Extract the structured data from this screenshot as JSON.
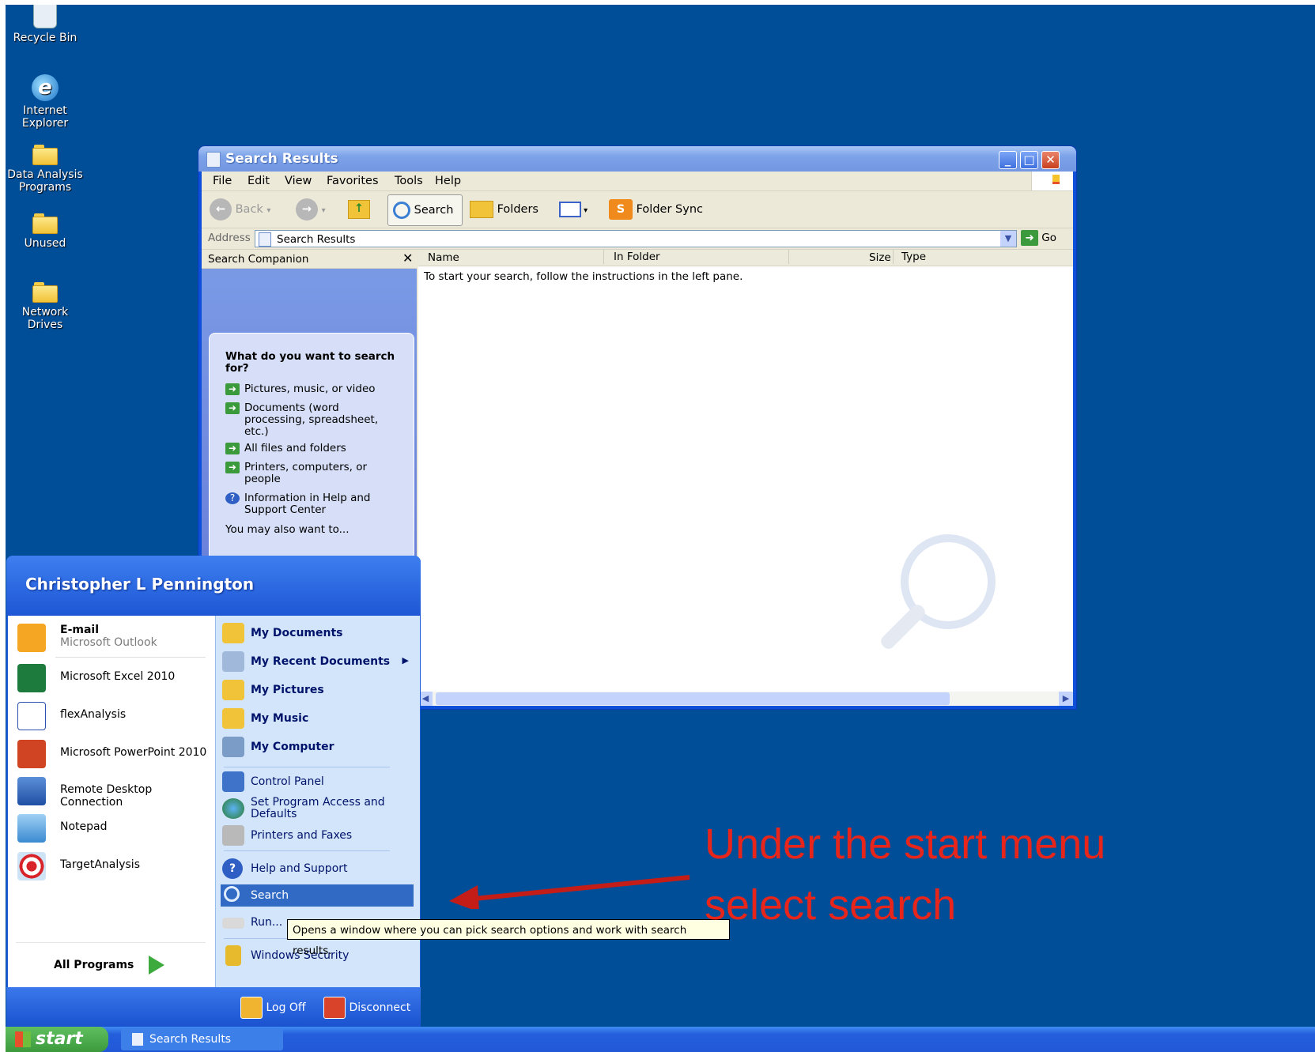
{
  "desktop": {
    "icons": [
      {
        "label": "Recycle Bin"
      },
      {
        "label": "Internet\nExplorer"
      },
      {
        "label": "Data Analysis\nPrograms"
      },
      {
        "label": "Unused"
      },
      {
        "label": "Network\nDrives"
      }
    ]
  },
  "window": {
    "title": "Search Results",
    "menu": [
      "File",
      "Edit",
      "View",
      "Favorites",
      "Tools",
      "Help"
    ],
    "toolbar": {
      "back": "Back",
      "search": "Search",
      "folders": "Folders",
      "folder_sync": "Folder Sync"
    },
    "address": {
      "label": "Address",
      "value": "Search Results",
      "go": "Go"
    },
    "companion": {
      "title": "Search Companion",
      "question": "What do you want to search for?",
      "options": [
        "Pictures, music, or video",
        "Documents (word processing, spreadsheet, etc.)",
        "All files and folders",
        "Printers, computers, or people",
        "Information in Help and Support Center"
      ],
      "also": "You may also want to..."
    },
    "columns": [
      "Name",
      "In Folder",
      "Size",
      "Type"
    ],
    "empty_message": "To start your search, follow the instructions in the left pane."
  },
  "start_menu": {
    "user": "Christopher L Pennington",
    "left_items": [
      {
        "label": "E-mail",
        "sub": "Microsoft Outlook"
      },
      {
        "label": "Microsoft Excel 2010"
      },
      {
        "label": "flexAnalysis"
      },
      {
        "label": "Microsoft PowerPoint 2010"
      },
      {
        "label": "Remote Desktop Connection"
      },
      {
        "label": "Notepad"
      },
      {
        "label": "TargetAnalysis"
      }
    ],
    "all_programs": "All Programs",
    "right_items": [
      {
        "label": "My Documents"
      },
      {
        "label": "My Recent Documents"
      },
      {
        "label": "My Pictures"
      },
      {
        "label": "My Music"
      },
      {
        "label": "My Computer"
      },
      {
        "label": "Control Panel"
      },
      {
        "label": "Set Program Access and Defaults"
      },
      {
        "label": "Printers and Faxes"
      },
      {
        "label": "Help and Support"
      },
      {
        "label": "Search"
      },
      {
        "label": "Run..."
      },
      {
        "label": "Windows Security"
      }
    ],
    "log_off": "Log Off",
    "disconnect": "Disconnect"
  },
  "tooltip": "Opens a window where you can pick search options and work with search results.",
  "annotation": "Under the start menu select search",
  "taskbar": {
    "start": "start",
    "items": [
      "Search Results"
    ]
  },
  "colors": {
    "desktop": "#004e98",
    "annotation": "#e8251b",
    "highlight": "#316ac5"
  }
}
